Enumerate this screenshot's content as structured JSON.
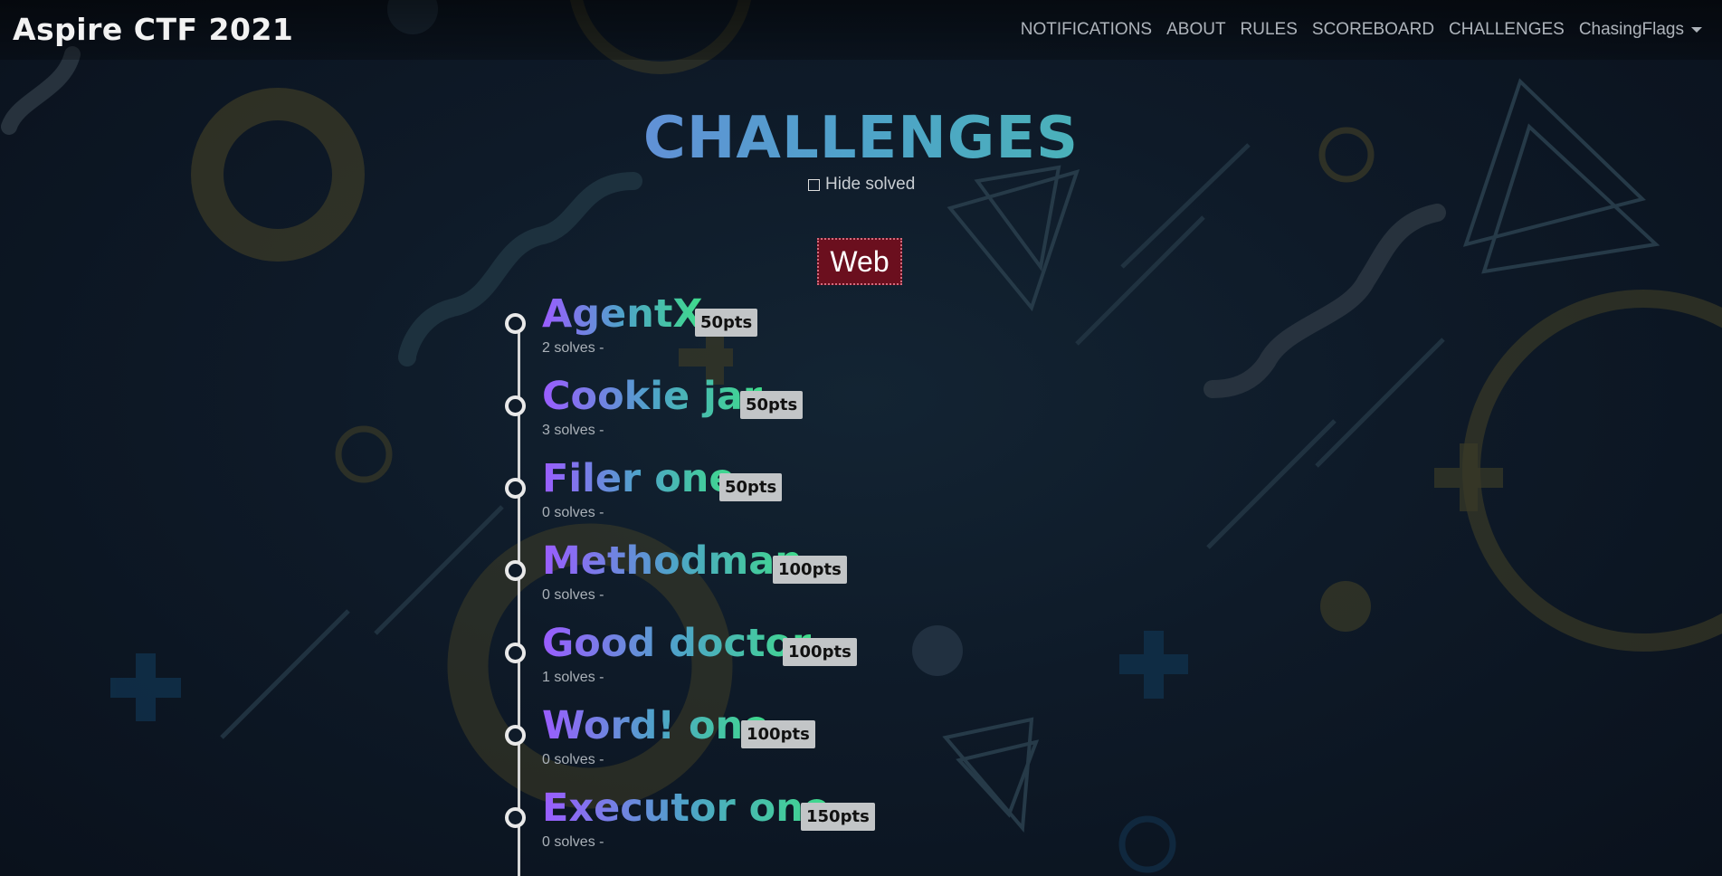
{
  "brand": "Aspire CTF 2021",
  "nav": {
    "notifications": "NOTIFICATIONS",
    "about": "ABOUT",
    "rules": "RULES",
    "scoreboard": "SCOREBOARD",
    "challenges": "CHALLENGES",
    "user": "ChasingFlags"
  },
  "page_title": "CHALLENGES",
  "hide_solved_label": "Hide solved",
  "category": "Web",
  "challenges": [
    {
      "name": "AgentX",
      "points": "50pts",
      "solves": "2 solves -"
    },
    {
      "name": "Cookie jar",
      "points": "50pts",
      "solves": "3 solves -"
    },
    {
      "name": "Filer one",
      "points": "50pts",
      "solves": "0 solves -"
    },
    {
      "name": "Methodman",
      "points": "100pts",
      "solves": "0 solves -"
    },
    {
      "name": "Good doctor",
      "points": "100pts",
      "solves": "1 solves -"
    },
    {
      "name": "Word! one",
      "points": "100pts",
      "solves": "0 solves -"
    },
    {
      "name": "Executor one",
      "points": "150pts",
      "solves": "0 solves -"
    }
  ],
  "colors": {
    "gradient_start": "#9b5cff",
    "gradient_mid": "#4ea3c9",
    "gradient_end": "#3fdc8a",
    "category_bg": "#6b0f1e"
  }
}
